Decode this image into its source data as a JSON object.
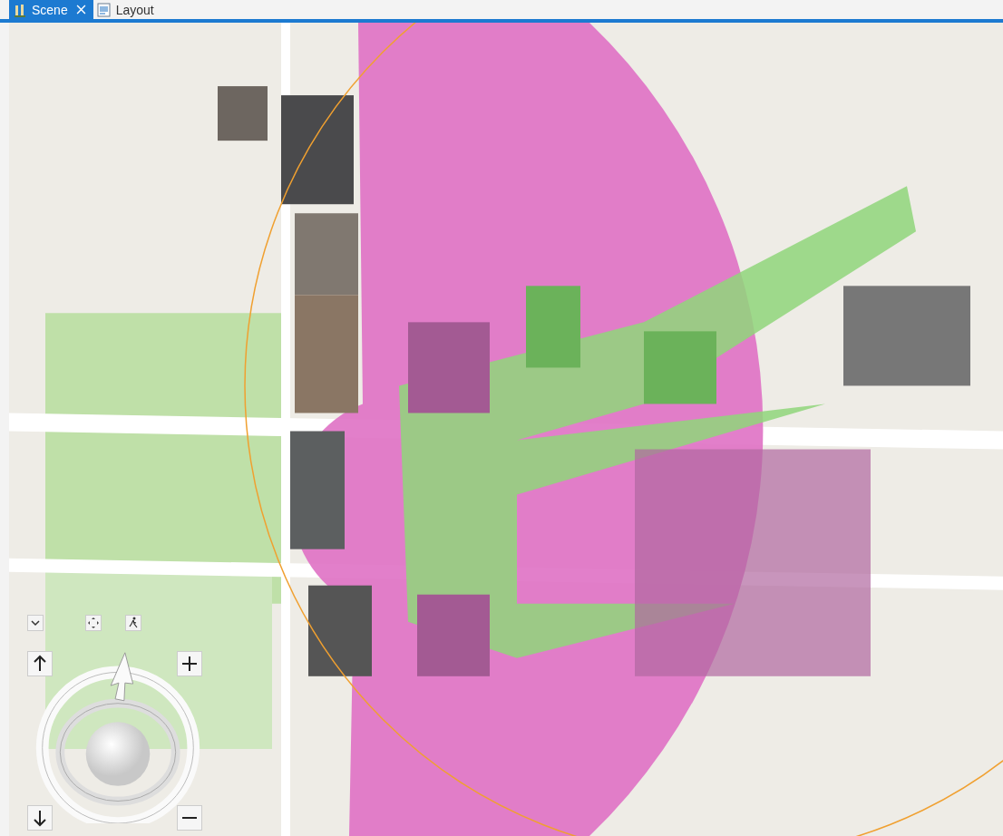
{
  "tabs": [
    {
      "label": "Scene",
      "kind": "scene",
      "selected": true,
      "closable": true
    },
    {
      "label": "Layout",
      "kind": "layout",
      "selected": false,
      "closable": false
    }
  ]
}
